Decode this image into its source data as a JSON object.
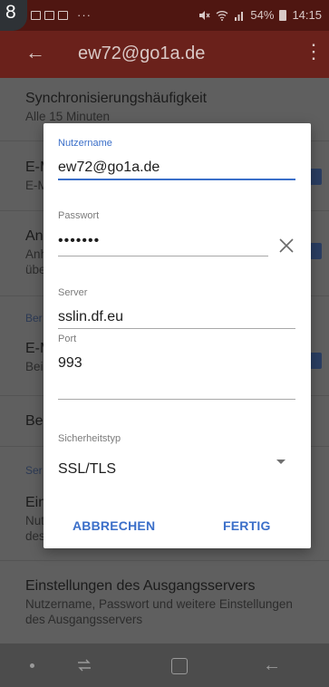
{
  "corner_badge": "8",
  "status_bar": {
    "notification_dots": "···",
    "battery": "54%",
    "time": "14:15",
    "icons": [
      "image-notification-icon",
      "gallery-notification-icon",
      "mail-notification-icon",
      "mute-icon",
      "wifi-icon",
      "signal-icon",
      "battery-icon"
    ]
  },
  "toolbar": {
    "back_icon": "←",
    "title": "ew72@go1a.de",
    "menu_icon": "⋮"
  },
  "background_list": {
    "sync": {
      "title": "Synchronisierungshäufigkeit",
      "subtitle": "Alle 15 Minuten"
    },
    "item2": {
      "title": "E-M",
      "subtitle": "E-M"
    },
    "item3": {
      "title": "An",
      "subtitle_lines": [
        "Anh",
        "übe"
      ]
    },
    "section1": "Ber",
    "item4": {
      "title": "E-M",
      "subtitle": "Bei"
    },
    "item5": {
      "title": "Bei"
    },
    "section2": "Ser",
    "item6": {
      "title": "Ein",
      "subtitle_lines": [
        "Nut",
        "des"
      ]
    },
    "outgoing": {
      "title": "Einstellungen des Ausgangsservers",
      "subtitle_lines": [
        "Nutzername, Passwort und weitere Einstellungen",
        "des Ausgangsservers"
      ]
    }
  },
  "dialog": {
    "username": {
      "label": "Nutzername",
      "value": "ew72@go1a.de"
    },
    "password": {
      "label": "Passwort",
      "value": "•••••••"
    },
    "server": {
      "label": "Server",
      "value": "sslin.df.eu"
    },
    "port": {
      "label": "Port",
      "value": "993"
    },
    "security": {
      "label": "Sicherheitstyp",
      "value": "SSL/TLS"
    },
    "cancel_label": "ABBRECHEN",
    "done_label": "FERTIG"
  },
  "colors": {
    "accent": "#3b6fc9",
    "toolbar": "#6a211b",
    "statusbar": "#4f1611"
  }
}
